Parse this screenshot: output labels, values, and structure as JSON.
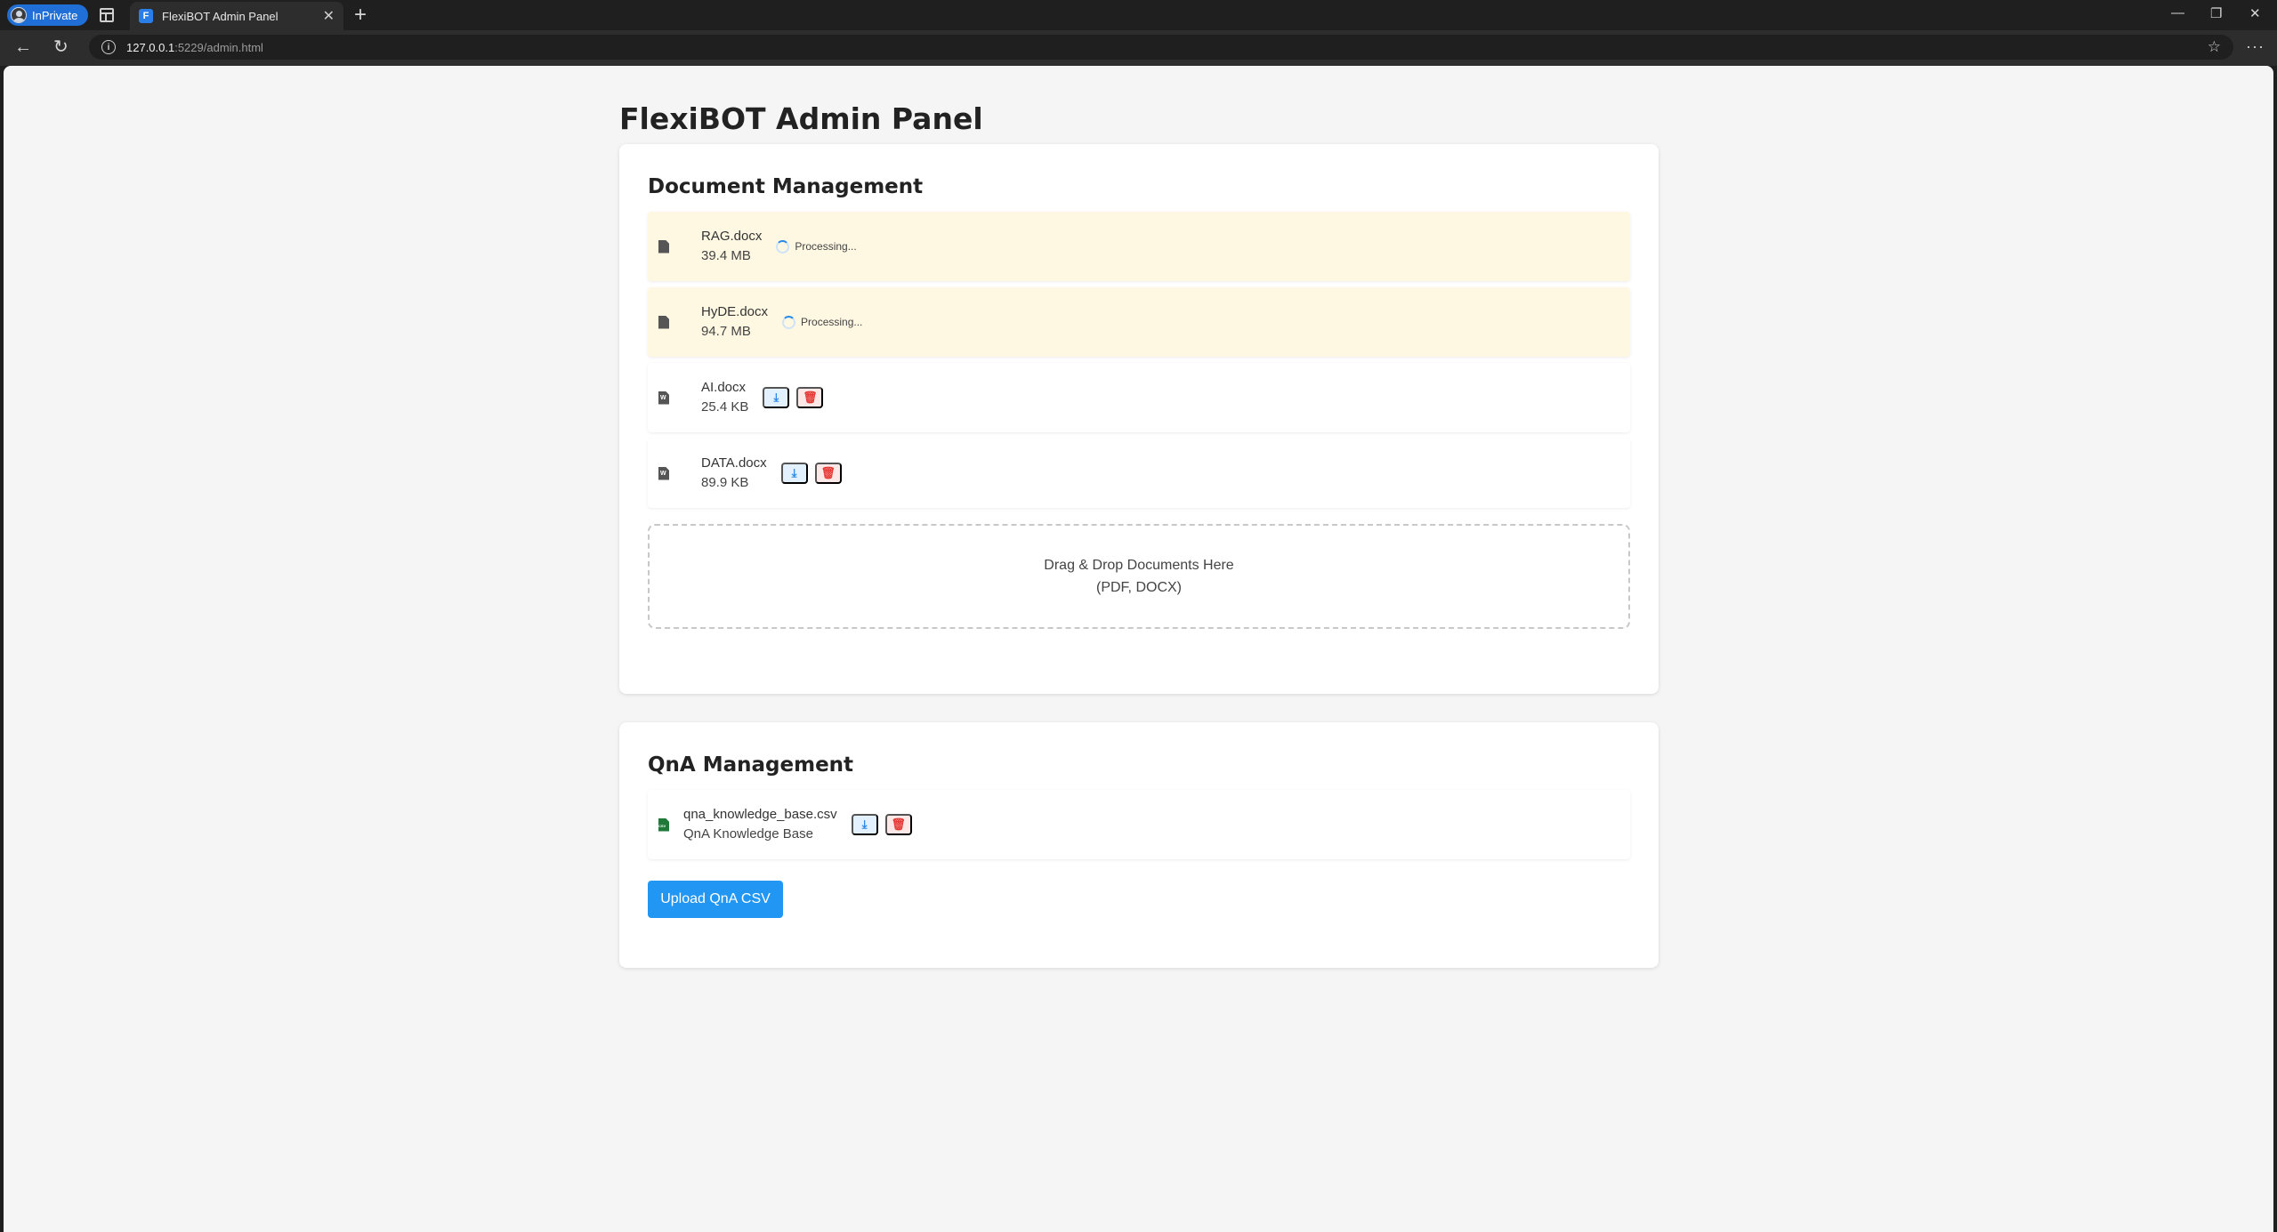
{
  "browser": {
    "inprivate_label": "InPrivate",
    "tab_title": "FlexiBOT Admin Panel",
    "favicon_letter": "F",
    "url_host": "127.0.0.1",
    "url_rest": ":5229/admin.html"
  },
  "page": {
    "title": "FlexiBOT Admin Panel"
  },
  "documents": {
    "heading": "Document Management",
    "items": [
      {
        "name": "RAG.docx",
        "size": "39.4 MB",
        "status": "Processing..."
      },
      {
        "name": "HyDE.docx",
        "size": "94.7 MB",
        "status": "Processing..."
      },
      {
        "name": "AI.docx",
        "size": "25.4 KB"
      },
      {
        "name": "DATA.docx",
        "size": "89.9 KB"
      }
    ],
    "dropzone": {
      "line1": "Drag & Drop Documents Here",
      "line2": "(PDF, DOCX)"
    }
  },
  "qna": {
    "heading": "QnA Management",
    "file": {
      "name": "qna_knowledge_base.csv",
      "description": "QnA Knowledge Base"
    },
    "upload_label": "Upload QnA CSV"
  },
  "colors": {
    "accent": "#2196f3",
    "processing_bg": "#fef8e3",
    "delete": "#e53935"
  }
}
